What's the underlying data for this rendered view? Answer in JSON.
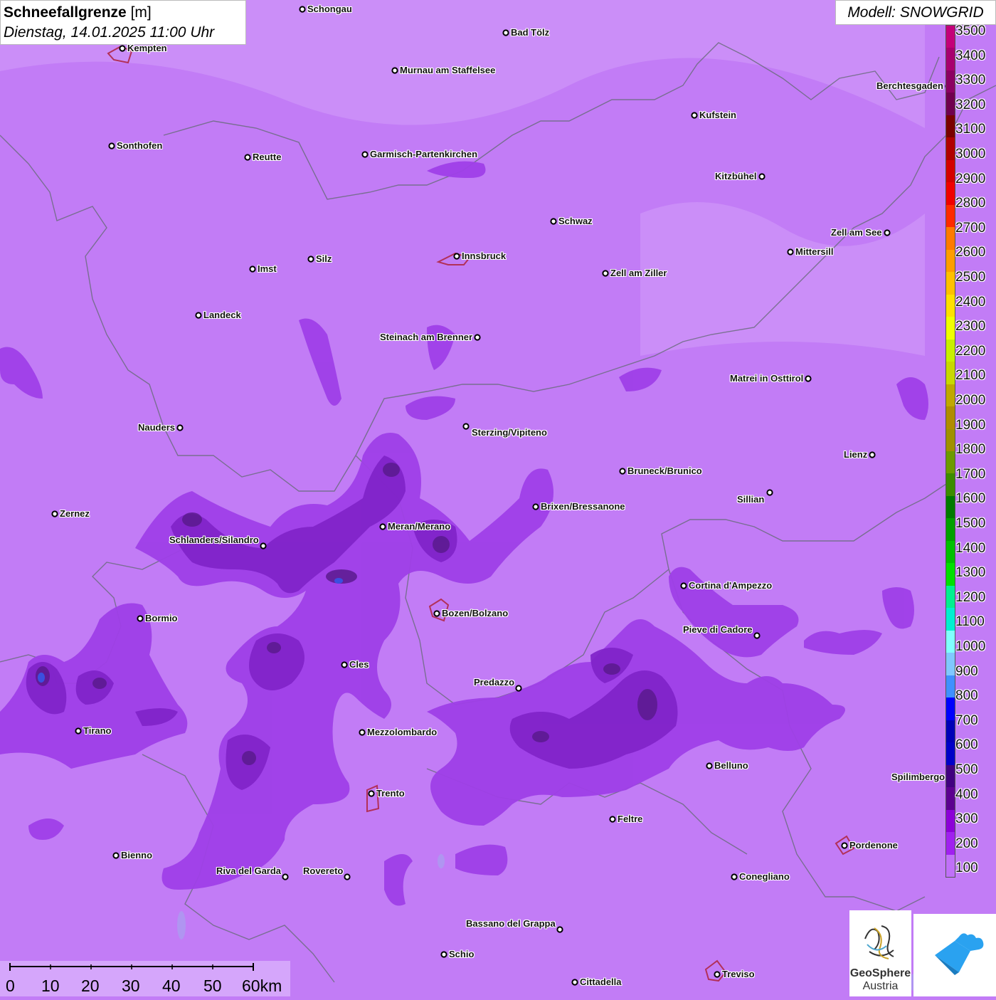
{
  "title": {
    "name": "Schneefallgrenze",
    "unit": "[m]",
    "date": "Dienstag, 14.01.2025 11:00 Uhr"
  },
  "model": "Modell: SNOWGRID",
  "colors": {
    "background": "#c27cf6",
    "band_300": "#9f3fe8",
    "band_400": "#7f22c8",
    "band_500": "#5a1a8e"
  },
  "legend": {
    "values": [
      "3500",
      "3400",
      "3300",
      "3200",
      "3100",
      "3000",
      "2900",
      "2800",
      "2700",
      "2600",
      "2500",
      "2400",
      "2300",
      "2200",
      "2100",
      "2000",
      "1900",
      "1800",
      "1700",
      "1600",
      "1500",
      "1400",
      "1300",
      "1200",
      "1100",
      "1000",
      "900",
      "800",
      "700",
      "600",
      "500",
      "400",
      "300",
      "200",
      "100"
    ],
    "colors": [
      "#c4007a",
      "#a8006e",
      "#8c0062",
      "#70004e",
      "#7a0000",
      "#b00000",
      "#d40000",
      "#f00000",
      "#ff2a00",
      "#ff7a00",
      "#ff9d00",
      "#ffc000",
      "#ffe000",
      "#f0ff00",
      "#c8f000",
      "#c8d800",
      "#c0a800",
      "#b08c00",
      "#a09000",
      "#6c9a00",
      "#3c8c00",
      "#007a00",
      "#00a000",
      "#00c000",
      "#00e000",
      "#00f090",
      "#00f0d0",
      "#80ffff",
      "#80c8ff",
      "#4090ff",
      "#0000ff",
      "#0000b8",
      "#0000c8",
      "#400080",
      "#5c0090",
      "#8c00d8",
      "#a020f0",
      "#c070f8"
    ]
  },
  "cities": [
    {
      "name": "Schongau"
    },
    {
      "name": "Bad Tölz"
    },
    {
      "name": "Kempten"
    },
    {
      "name": "Murnau am Staffelsee"
    },
    {
      "name": "Berchtesgaden"
    },
    {
      "name": "Kufstein"
    },
    {
      "name": "Sonthofen"
    },
    {
      "name": "Reutte"
    },
    {
      "name": "Garmisch-Partenkirchen"
    },
    {
      "name": "Kitzbühel"
    },
    {
      "name": "Schwaz"
    },
    {
      "name": "Zell am See"
    },
    {
      "name": "Innsbruck"
    },
    {
      "name": "Mittersill"
    },
    {
      "name": "Imst"
    },
    {
      "name": "Silz"
    },
    {
      "name": "Zell am Ziller"
    },
    {
      "name": "Landeck"
    },
    {
      "name": "Steinach am Brenner"
    },
    {
      "name": "Matrei in Osttirol"
    },
    {
      "name": "Nauders"
    },
    {
      "name": "Sterzing/Vipiteno"
    },
    {
      "name": "Lienz"
    },
    {
      "name": "Bruneck/Brunico"
    },
    {
      "name": "Sillian"
    },
    {
      "name": "Zernez"
    },
    {
      "name": "Brixen/Bressanone"
    },
    {
      "name": "Meran/Merano"
    },
    {
      "name": "Schlanders/Silandro"
    },
    {
      "name": "Cortina d'Ampezzo"
    },
    {
      "name": "Bozen/Bolzano"
    },
    {
      "name": "Bormio"
    },
    {
      "name": "Pieve di Cadore"
    },
    {
      "name": "Cles"
    },
    {
      "name": "Predazzo"
    },
    {
      "name": "Tirano"
    },
    {
      "name": "Mezzolombardo"
    },
    {
      "name": "Belluno"
    },
    {
      "name": "Spilimbergo"
    },
    {
      "name": "Trento"
    },
    {
      "name": "Feltre"
    },
    {
      "name": "Pordenone"
    },
    {
      "name": "Bienno"
    },
    {
      "name": "Riva del Garda"
    },
    {
      "name": "Rovereto"
    },
    {
      "name": "Conegliano"
    },
    {
      "name": "Bassano del Grappa"
    },
    {
      "name": "Schio"
    },
    {
      "name": "Treviso"
    },
    {
      "name": "Cittadella"
    }
  ],
  "scale": {
    "labels": [
      "0",
      "10",
      "20",
      "30",
      "40",
      "50",
      "60km"
    ]
  },
  "logo": {
    "name": "GeoSphere",
    "sub": "Austria"
  }
}
